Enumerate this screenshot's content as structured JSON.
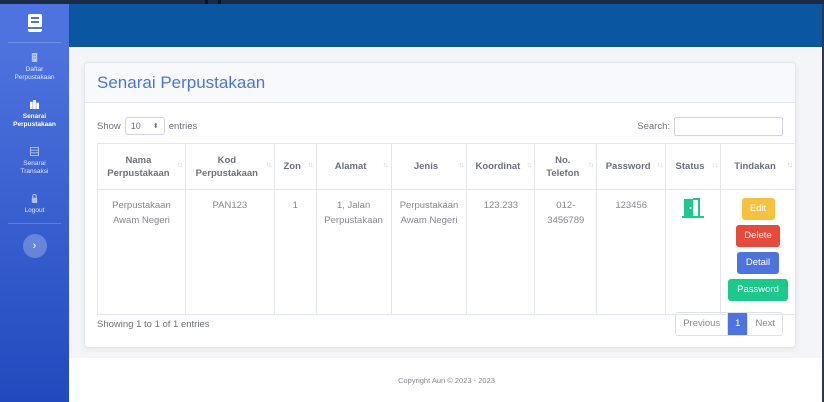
{
  "sidebar": {
    "brand_icon": "book-icon",
    "items": [
      {
        "label": "Daftar\nPerpustakaan",
        "icon": "building-icon"
      },
      {
        "label": "Senarai\nPerpustakaan",
        "icon": "library-icon"
      },
      {
        "label": "Senarai\nTransaksi",
        "icon": "table-icon"
      },
      {
        "label": "Logout",
        "icon": "lock-icon"
      }
    ],
    "toggle_icon": "chevron-right-icon",
    "toggle_glyph": "›"
  },
  "page": {
    "title": "Senarai Perpustakaan"
  },
  "table_controls": {
    "show_label": "Show",
    "page_length": "10",
    "entries_label": "entries",
    "search_label": "Search:",
    "search_value": ""
  },
  "table": {
    "columns": [
      "Nama Perpustakaan",
      "Kod Perpustakaan",
      "Zon",
      "Alamat",
      "Jenis",
      "Koordinat",
      "No. Telefon",
      "Password",
      "Status",
      "Tindakan"
    ],
    "rows": [
      {
        "nama": "Perpustakaan Awam Negeri",
        "kod": "PAN123",
        "zon": "1",
        "alamat": "1, Jalan Perpustakaan",
        "jenis": "Perpustakaan Awam Negeri",
        "koordinat": "123.233",
        "telefon": "012-3456789",
        "password": "123456",
        "status_icon": "door-open-icon",
        "actions": [
          "Edit",
          "Delete",
          "Detail",
          "Password"
        ]
      }
    ]
  },
  "pagination": {
    "info": "Showing 1 to 1 of 1 entries",
    "previous": "Previous",
    "current": "1",
    "next": "Next"
  },
  "footer": {
    "text": "Copyright Auri © 2023 - 2023"
  },
  "colors": {
    "primary": "#4e73df",
    "topbar": "#0a56a0",
    "edit": "#f6c23e",
    "delete": "#e74a3b",
    "detail": "#4e73df",
    "password": "#1cc88a"
  }
}
